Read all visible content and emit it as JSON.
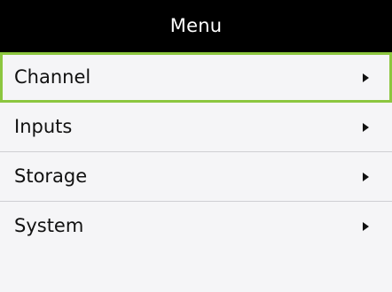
{
  "header": {
    "title": "Menu"
  },
  "menu": {
    "selected_index": 0,
    "items": [
      {
        "label": "Channel",
        "icon": "chevron-right-icon"
      },
      {
        "label": "Inputs",
        "icon": "chevron-right-icon"
      },
      {
        "label": "Storage",
        "icon": "chevron-right-icon"
      },
      {
        "label": "System",
        "icon": "chevron-right-icon"
      }
    ]
  },
  "colors": {
    "header_bg": "#000000",
    "header_text": "#ffffff",
    "selection_border": "#8cc63f",
    "item_bg": "#f5f5f7",
    "divider": "#cfcfd3",
    "text": "#111111"
  }
}
